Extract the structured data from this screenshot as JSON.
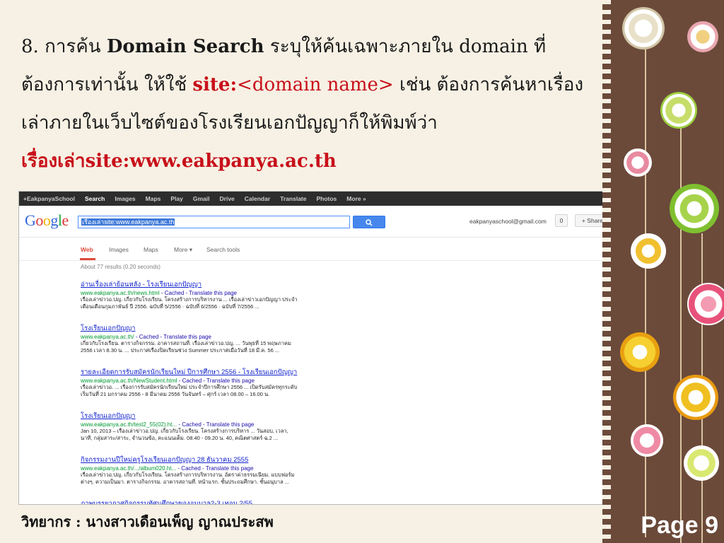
{
  "slide": {
    "line1_prefix": "8. การค้น ",
    "line1_bold": "Domain Search",
    "line1_suffix": " ระบุให้ค้นเฉพาะภายใน domain ที่",
    "line2_prefix": "ต้องการเท่านั้น ให้ใช้ ",
    "line2_site": "site:",
    "line2_domain": "<domain name>",
    "line2_suffix": " เช่น ต้องการค้นหาเรื่อง",
    "line3": "เล่าภายในเว็บไซต์ของโรงเรียนเอกปัญญาก็ให้พิมพ์ว่า",
    "line4": "เรื่องเล่าsite:www.eakpanya.ac.th",
    "credit": "วิทยากร : นางสาวเดือนเพ็ญ ญาณประสพ",
    "page": "Page 9"
  },
  "gbar": {
    "items": [
      "+EakpanyaSchool",
      "Search",
      "Images",
      "Maps",
      "Play",
      "Gmail",
      "Drive",
      "Calendar",
      "Translate",
      "Photos",
      "More »"
    ]
  },
  "header": {
    "logo": "Google",
    "query": "เรื่องเล่าsite:www.eakpanya.ac.th",
    "search_icon": "search-icon",
    "account": "eakpanyaschool@gmail.com",
    "notifications": "0",
    "share": "+ Share"
  },
  "tabs": {
    "items": [
      "Web",
      "Images",
      "Maps",
      "More ▾",
      "Search tools"
    ],
    "settings_icon": "gear-icon"
  },
  "stats": "About 77 results (0.20 seconds)",
  "results": [
    {
      "title": "อ่านเรื่องเล่าย้อนหลัง - โรงเรียนเอกปัญญา",
      "url": "www.eakpanya.ac.th/news.html",
      "links": " - Cached - Translate this page",
      "snippet1": "เรื่องเล่าข่าวอ.ปญ. เกี่ยวกับโรงเรียน. โครงสร้างการบริหารงาน ... เรื่องเล่าข่าวเอกปัญญา ประจำ",
      "snippet2": "เดือนเดือนกุมภาพันธ์ ปี 2556. ฉบับที่ 5/2556 · ฉบับที่ 6/2556 · ฉบับที่ 7/2556 ..."
    },
    {
      "title": "โรงเรียนเอกปัญญา",
      "url": "www.eakpanya.ac.th/",
      "links": " - Cached - Translate this page",
      "snippet1": "เกี่ยวกับโรงเรียน. ตารางกิจกรรม. อาคารสถานที่. เรื่องเล่าข่าวอ.ปญ. ... วันพุธที่ 15 พฤษภาคม",
      "snippet2": "2556 เวลา 8.30 น. ... ประกาศเรื่องปิดเรียนช่วง Summer ประกาศเมื่อวันที่ 18 มี.ค. 56 ..."
    },
    {
      "title": "รายละเอียดการรับสมัครนักเรียนใหม่ ปีการศึกษา 2556 - โรงเรียนเอกปัญญา",
      "url": "www.eakpanya.ac.th/NewStudent.html",
      "links": " - Cached - Translate this page",
      "snippet1": "เรื่องเล่าข่าวอ. ... เรื่องการรับสมัครนักเรียนใหม่ ประจำปีการศึกษา 2556 ... เปิดรับสมัครทุกระดับ",
      "snippet2": "เริ่มวันที่ 21 มกราคม 2556 - 8 มีนาคม 2556 วันจันทร์ – ศุกร์ เวลา 08.00 – 16.00 น."
    },
    {
      "title": "โรงเรียนเอกปัญญา",
      "url": "www.eakpanya.ac.th/test2_55(02).ht...",
      "links": " - Cached - Translate this page",
      "snippet1": "Jan 10, 2013 – เรื่องเล่าข่าวอ.ปญ. เกี่ยวกับโรงเรียน. โครงสร้างการบริหาร ... วันสอบ, เวลา,",
      "snippet2": "นาที, กลุ่มสาระ/สาระ, จำนวนข้อ, คะแนนเต็ม. 08.40 - 09.20 น. 40, คณิตศาสตร์ ฉ.2 ..."
    },
    {
      "title": "กิจกรรมงานปีใหม่ครูโรงเรียนเอกปัญญา 28 ธันวาคม 2555",
      "url": "www.eakpanya.ac.th/.../album020.ht...",
      "links": " - Cached - Translate this page",
      "snippet1": "เรื่องเล่าข่าวอ.ปญ. เกี่ยวกับโรงเรียน. โครงสร้างการบริหารงาน. อัตราค่าธรรมเนียม. แบบฟอร์ม",
      "snippet2": "ต่างๆ. ความเป็นมา. ตารางกิจกรรม. อาคารสถานที่. หน้าแรก. ชั้นประถมศึกษา. ชั้นอนุบาล ..."
    },
    {
      "title": "ภาพบรรยากาศกิจกรรมทัศนศึกษาของอนุบาล2-3 เทอม 2/55",
      "url": "",
      "links": "",
      "snippet1": "",
      "snippet2": ""
    }
  ],
  "colors": {
    "background": "#f6f1e4",
    "accent_red": "#c8101a",
    "link_blue": "#1122cc",
    "url_green": "#009933",
    "deco_brown": "#6b4a3a"
  }
}
